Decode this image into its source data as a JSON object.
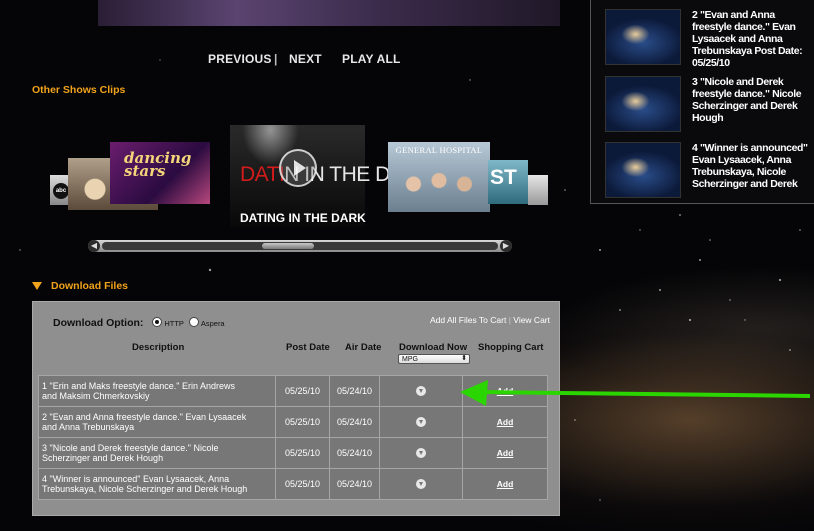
{
  "clip_nav": {
    "previous": "PREVIOUS",
    "separator": "|",
    "next": "NEXT",
    "play_all": "PLAY ALL"
  },
  "playlist": [
    {
      "text": "2 \"Evan and Anna freestyle dance.\" Evan Lysaacek and Anna Trebunskaya Post Date: 05/25/10"
    },
    {
      "text": "3 \"Nicole and Derek freestyle dance.\" Nicole Scherzinger and Derek Hough"
    },
    {
      "text": "4 \"Winner is announced\" Evan Lysaacek, Anna Trebunskaya, Nicole Scherzinger and Derek"
    }
  ],
  "other_shows": {
    "title": "Other Shows Clips",
    "abc_logo": "abc",
    "dwts_text": "dancing stars",
    "featured_title_red": "DATI",
    "featured_title_rest": "N IN THE DARK",
    "featured_caption": "DATING IN THE DARK",
    "general_hospital": "GENERAL HOSPITAL",
    "st_text": "ST"
  },
  "download": {
    "section_title": "Download Files",
    "option_label": "Download Option:",
    "option_http": "HTTP",
    "option_aspera": "Aspera",
    "add_all": "Add All Files To Cart",
    "link_separator": "|",
    "view_cart": "View Cart",
    "headers": {
      "description": "Description",
      "post_date": "Post Date",
      "air_date": "Air Date",
      "download_now": "Download Now",
      "shopping_cart": "Shopping Cart"
    },
    "format_selected": "MPG",
    "rows": [
      {
        "desc1": "1 \"Erin and Maks freestyle dance.\" Erin Andrews",
        "desc2": "and Maksim Chmerkovskiy",
        "post": "05/25/10",
        "air": "05/24/10",
        "cart": "Add"
      },
      {
        "desc1": "2 \"Evan and Anna freestyle dance.\" Evan Lysaacek",
        "desc2": "and Anna Trebunskaya",
        "post": "05/25/10",
        "air": "05/24/10",
        "cart": "Add"
      },
      {
        "desc1": "3 \"Nicole and Derek freestyle dance.\" Nicole",
        "desc2": "Scherzinger and Derek Hough",
        "post": "05/25/10",
        "air": "05/24/10",
        "cart": "Add"
      },
      {
        "desc1": "4 \"Winner is announced\" Evan Lysaacek, Anna",
        "desc2": "Trebunskaya, Nicole Scherzinger and Derek Hough",
        "post": "05/25/10",
        "air": "05/24/10",
        "cart": "Add"
      }
    ]
  },
  "annotation": {
    "arrow_color": "#2bd600"
  },
  "colors": {
    "accent_orange": "#f2a31c",
    "panel_gray": "#8f8f8f"
  }
}
